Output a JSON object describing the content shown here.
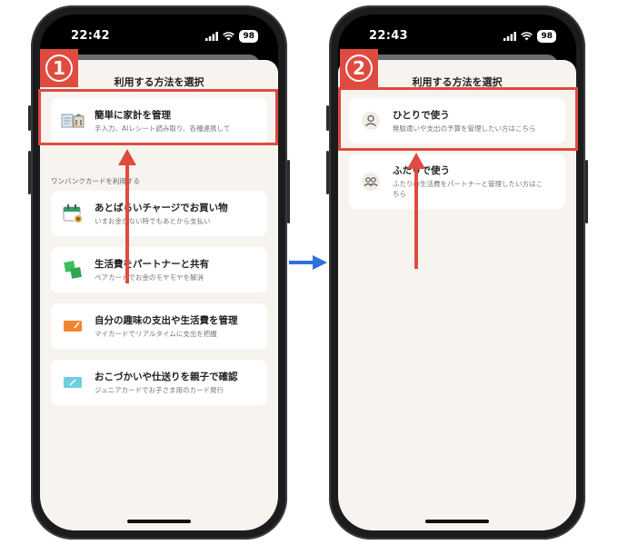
{
  "left_phone": {
    "time": "22:42",
    "battery": "98",
    "sheet_title": "利用する方法を選択",
    "step": "1",
    "top_card": {
      "title": "簡単に家計を管理",
      "subtitle": "手入力、AIレシート読み取り、各種連携して",
      "icon": "ledger-icon"
    },
    "section_label": "ワンバンクカードを利用する",
    "cards": [
      {
        "title": "あとばらいチャージでお買い物",
        "subtitle": "いまお金がない時でもあとから支払い",
        "icon": "calendar-icon",
        "color": "#2f9e62"
      },
      {
        "title": "生活費をパートナーと共有",
        "subtitle": "ペアカードでお金のモヤモヤを解消",
        "icon": "pair-card-icon",
        "color": "#3bbf5e"
      },
      {
        "title": "自分の趣味の支出や生活費を管理",
        "subtitle": "マイカードでリアルタイムに支出を把握",
        "icon": "my-card-icon",
        "color": "#f2842b"
      },
      {
        "title": "おこづかいや仕送りを親子で確認",
        "subtitle": "ジュニアカードでお子さま用のカード発行",
        "icon": "junior-card-icon",
        "color": "#6fcfe0"
      }
    ]
  },
  "right_phone": {
    "time": "22:43",
    "battery": "98",
    "sheet_title": "利用する方法を選択",
    "step": "2",
    "cards": [
      {
        "title": "ひとりで使う",
        "subtitle": "無駄遣いや支出の予算を管理したい方はこちら",
        "icon": "person-icon"
      },
      {
        "title": "ふたりで使う",
        "subtitle": "ふたりの生活費をパートナーと管理したい方はこちら",
        "icon": "two-people-icon"
      }
    ]
  },
  "colors": {
    "highlight": "#e04b3f",
    "arrow_blue": "#2f6fe0",
    "sheet_bg": "#f7f4ef"
  }
}
